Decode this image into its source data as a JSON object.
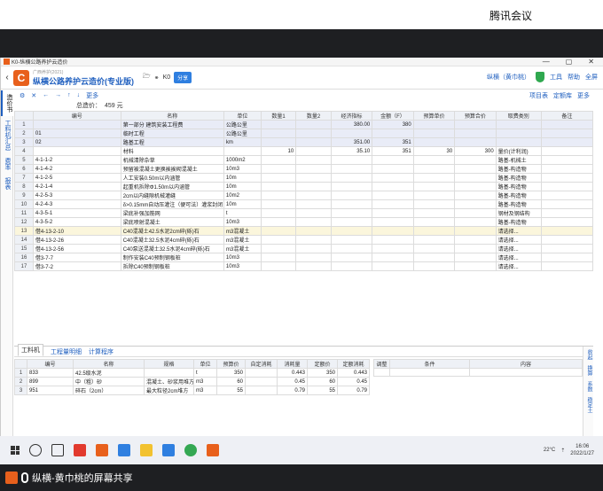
{
  "meeting": {
    "title": "腾讯会议",
    "share_label": "纵横-黄巾桃的屏幕共享"
  },
  "window": {
    "title": "K0-纵横公路养护云造价",
    "min": "—",
    "max": "▢",
    "close": "✕"
  },
  "app": {
    "sub": "广西养护(2021)",
    "name": "纵横公路养护云造价(专业版)",
    "file_label": "K0",
    "share": "分享",
    "user": "纵横（黄巾桃）",
    "tools": "工具",
    "help": "帮助",
    "fullscreen": "全屏"
  },
  "left_tabs": [
    "造价书",
    "工料机汇总",
    "费率",
    "报表"
  ],
  "toolbar": {
    "more": "更多",
    "right": [
      "项目表",
      "定额库",
      "更多"
    ]
  },
  "total": {
    "label": "总造价：",
    "value": "459 元"
  },
  "columns": [
    "",
    "编号",
    "名称",
    "单位",
    "数量1",
    "数量2",
    "经济指标",
    "金额（F）",
    "预算单价",
    "预算合价",
    "取费类别",
    "备注"
  ],
  "rows": [
    {
      "n": "1",
      "code": "",
      "name": "第一部分 建筑安装工程费",
      "unit": "公路公里",
      "q1": "",
      "q2": "",
      "eco": "380.00",
      "amt": "380",
      "up": "",
      "tp": "",
      "fee": "",
      "note": "",
      "cls": "hl"
    },
    {
      "n": "2",
      "code": "01",
      "name": "临时工程",
      "unit": "公路公里",
      "q1": "",
      "q2": "",
      "eco": "",
      "amt": "",
      "up": "",
      "tp": "",
      "fee": "",
      "note": "",
      "cls": "hl"
    },
    {
      "n": "3",
      "code": "02",
      "name": "路基工程",
      "unit": "km",
      "q1": "",
      "q2": "",
      "eco": "351.00",
      "amt": "351",
      "up": "",
      "tp": "",
      "fee": "",
      "note": "",
      "cls": "hl"
    },
    {
      "n": "4",
      "code": "",
      "name": "材料",
      "unit": "",
      "q1": "10",
      "q2": "",
      "eco": "35.10",
      "amt": "351",
      "up": "30",
      "tp": "300",
      "fee": "量价(计利润)",
      "note": "",
      "cls": ""
    },
    {
      "n": "5",
      "code": "4-1-1-2",
      "name": "机械清除杂草",
      "unit": "1000m2",
      "q1": "",
      "q2": "",
      "eco": "",
      "amt": "",
      "up": "",
      "tp": "",
      "fee": "路基-机械土",
      "note": "",
      "cls": ""
    },
    {
      "n": "6",
      "code": "4-1-4-2",
      "name": "预留被混凝土更换挨挨砌混凝土",
      "unit": "10m3",
      "q1": "",
      "q2": "",
      "eco": "",
      "amt": "",
      "up": "",
      "tp": "",
      "fee": "路基-构造物",
      "note": "",
      "cls": ""
    },
    {
      "n": "7",
      "code": "4-1-2-5",
      "name": "人工安装0.50m以内涵管",
      "unit": "10m",
      "q1": "",
      "q2": "",
      "eco": "",
      "amt": "",
      "up": "",
      "tp": "",
      "fee": "路基-构造物",
      "note": "",
      "cls": ""
    },
    {
      "n": "8",
      "code": "4-2-1-4",
      "name": "起重机拆除Φ1.50m以内涵管",
      "unit": "10m",
      "q1": "",
      "q2": "",
      "eco": "",
      "amt": "",
      "up": "",
      "tp": "",
      "fee": "路基-构造物",
      "note": "",
      "cls": ""
    },
    {
      "n": "9",
      "code": "4-2-5-3",
      "name": "2cm以内缝隙机械灌缝",
      "unit": "10m2",
      "q1": "",
      "q2": "",
      "eco": "",
      "amt": "",
      "up": "",
      "tp": "",
      "fee": "路基-构造物",
      "note": "",
      "cls": ""
    },
    {
      "n": "10",
      "code": "4-2-4-3",
      "name": "δ>0.15mm自动压灌注（便可法）灌浆封闭",
      "unit": "10m",
      "q1": "",
      "q2": "",
      "eco": "",
      "amt": "",
      "up": "",
      "tp": "",
      "fee": "路基-构造物",
      "note": "",
      "cls": ""
    },
    {
      "n": "11",
      "code": "4-3-5-1",
      "name": "梁底补强加筋网",
      "unit": "t",
      "q1": "",
      "q2": "",
      "eco": "",
      "amt": "",
      "up": "",
      "tp": "",
      "fee": "钢材及钢结构",
      "note": "",
      "cls": ""
    },
    {
      "n": "12",
      "code": "4-3-5-2",
      "name": "梁底喷射混凝土",
      "unit": "10m3",
      "q1": "",
      "q2": "",
      "eco": "",
      "amt": "",
      "up": "",
      "tp": "",
      "fee": "路基-构造物",
      "note": "",
      "cls": ""
    },
    {
      "n": "13",
      "code": "借4-13-2-10",
      "name": "C40混凝土42.5水泥2cm碎(砾)石",
      "unit": "m3混凝土",
      "q1": "",
      "q2": "",
      "eco": "",
      "amt": "",
      "up": "",
      "tp": "",
      "fee": "请选择...",
      "note": "",
      "cls": "sel"
    },
    {
      "n": "14",
      "code": "借4-13-2-26",
      "name": "C40混凝土32.5水泥4cm碎(砾)石",
      "unit": "m3混凝土",
      "q1": "",
      "q2": "",
      "eco": "",
      "amt": "",
      "up": "",
      "tp": "",
      "fee": "请选择...",
      "note": "",
      "cls": ""
    },
    {
      "n": "15",
      "code": "借4-13-2-56",
      "name": "C40泵送混凝土32.5水泥4cm碎(砾)石",
      "unit": "m3混凝土",
      "q1": "",
      "q2": "",
      "eco": "",
      "amt": "",
      "up": "",
      "tp": "",
      "fee": "请选择...",
      "note": "",
      "cls": ""
    },
    {
      "n": "16",
      "code": "借3-7-7",
      "name": "制作安装C40预制钢板桩",
      "unit": "10m3",
      "q1": "",
      "q2": "",
      "eco": "",
      "amt": "",
      "up": "",
      "tp": "",
      "fee": "请选择...",
      "note": "",
      "cls": ""
    },
    {
      "n": "17",
      "code": "借3-7-2",
      "name": "拆除C40预制钢板桩",
      "unit": "10m3",
      "q1": "",
      "q2": "",
      "eco": "",
      "amt": "",
      "up": "",
      "tp": "",
      "fee": "请选择...",
      "note": "",
      "cls": ""
    }
  ],
  "bottom_tabs": [
    "工料机",
    "工程量明细",
    "计算程序"
  ],
  "lower_columns": [
    "",
    "编号",
    "名称",
    "规格",
    "单位",
    "预算价",
    "自定消耗",
    "消耗量",
    "定额价",
    "定额消耗"
  ],
  "lower_rows": [
    {
      "n": "1",
      "code": "833",
      "name": "42.5级水泥",
      "spec": "",
      "unit": "t",
      "price": "350",
      "self": "",
      "qty": "0.443",
      "dprice": "350",
      "dqty": "0.443"
    },
    {
      "n": "2",
      "code": "899",
      "name": "中（粗）砂",
      "spec": "混凝土、砂浆用堆方",
      "unit": "m3",
      "price": "60",
      "self": "",
      "qty": "0.45",
      "dprice": "60",
      "dqty": "0.45"
    },
    {
      "n": "3",
      "code": "951",
      "name": "碎石（2cm）",
      "spec": "最大粒径2cm堆方",
      "unit": "m3",
      "price": "55",
      "self": "",
      "qty": "0.79",
      "dprice": "55",
      "dqty": "0.79"
    }
  ],
  "right_columns": [
    "调整",
    "条件",
    "内容"
  ],
  "right_side": [
    "收起",
    "换算",
    "系数",
    "稳定土"
  ],
  "taskbar": {
    "weather": "22°C",
    "time": "16:06",
    "date": "2022/1/27"
  }
}
